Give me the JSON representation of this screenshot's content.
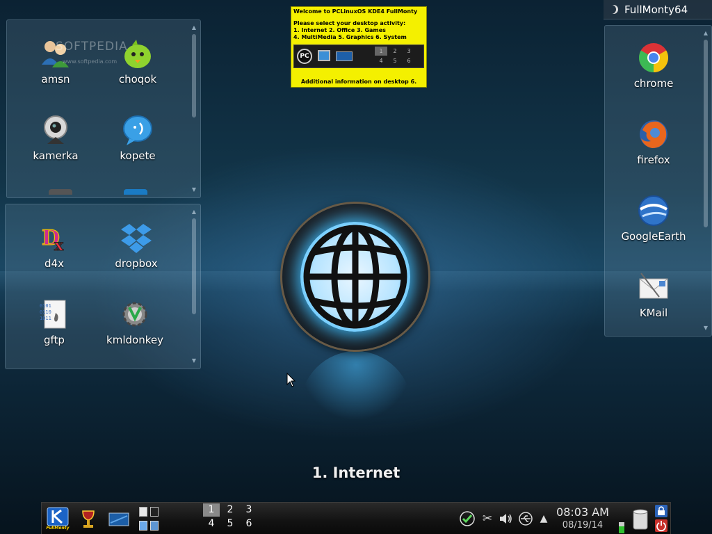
{
  "desktop": {
    "activity_label": "1. Internet"
  },
  "left_panel_top": {
    "icons": [
      {
        "label": "amsn"
      },
      {
        "label": "choqok"
      },
      {
        "label": "kamerka"
      },
      {
        "label": "kopete"
      }
    ]
  },
  "left_panel_bottom": {
    "icons": [
      {
        "label": "d4x"
      },
      {
        "label": "dropbox"
      },
      {
        "label": "gftp"
      },
      {
        "label": "kmldonkey"
      }
    ]
  },
  "right_panel": {
    "title": "FullMonty64",
    "icons": [
      {
        "label": "chrome"
      },
      {
        "label": "firefox"
      },
      {
        "label": "GoogleEarth"
      },
      {
        "label": "KMail"
      }
    ]
  },
  "info_widget": {
    "line1": "Welcome to PCLinuxOS KDE4 FullMonty",
    "line2": "Please select your desktop activity:",
    "line3": "1. Internet     2. Office     3. Games",
    "line4": "4. MultiMedia  5. Graphics  6. System",
    "footer": "Additional information on desktop 6.",
    "pager_digits": [
      "1",
      "2",
      "3",
      "4",
      "5",
      "6"
    ]
  },
  "watermark": {
    "brand": "SOFTPEDIA",
    "url": "www.softpedia.com"
  },
  "taskbar": {
    "launcher_label": "FullMonty",
    "pager": {
      "desktops": [
        "1",
        "2",
        "3",
        "4",
        "5",
        "6"
      ],
      "active": "1"
    },
    "clock": {
      "time": "08:03 AM",
      "date": "08/19/14"
    }
  }
}
